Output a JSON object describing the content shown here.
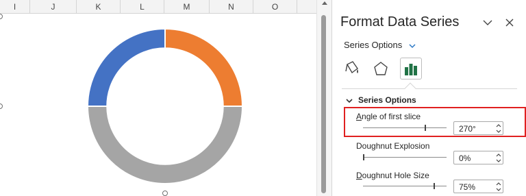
{
  "sheet": {
    "columns": [
      "I",
      "J",
      "K",
      "L",
      "M",
      "N",
      "O"
    ]
  },
  "chart_data": {
    "type": "pie",
    "variant": "doughnut",
    "title": "",
    "first_slice_angle_deg": 270,
    "hole_size_pct": 75,
    "series": [
      {
        "values": [
          25,
          25,
          50
        ]
      }
    ],
    "colors": [
      "#4472c4",
      "#ed7d31",
      "#a5a5a5"
    ]
  },
  "pane": {
    "title": "Format Data Series",
    "series_options_dropdown": "Series Options",
    "section_title": "Series Options",
    "icons": {
      "fill": "paint-bucket-icon",
      "effects": "pentagon-icon",
      "options": "bar-chart-icon",
      "collapse": "chevron-down-icon",
      "close": "close-icon"
    },
    "settings": [
      {
        "label_first": "A",
        "label_rest": "ngle of first slice",
        "value": "270°",
        "slider_pct": 75
      },
      {
        "label_first": "",
        "label_rest": "Doughnut Explosion",
        "value": "0%",
        "slider_pct": 0
      },
      {
        "label_first": "D",
        "label_rest": "oughnut Hole Size",
        "value": "75%",
        "slider_pct": 86
      }
    ],
    "accent_color": "#217346",
    "highlight_color": "#e02020"
  }
}
